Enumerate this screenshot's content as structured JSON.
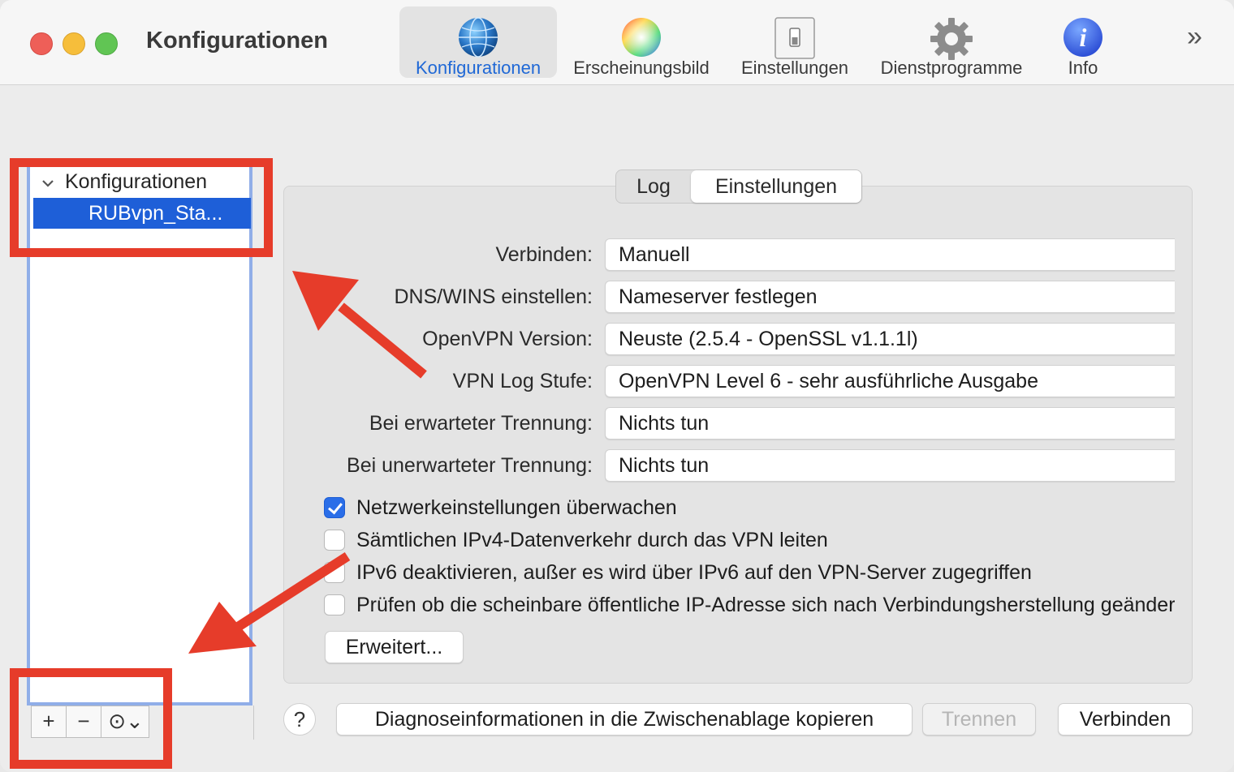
{
  "window": {
    "title": "Konfigurationen"
  },
  "toolbar": {
    "items": [
      {
        "label": "Konfigurationen",
        "icon": "globe-icon"
      },
      {
        "label": "Erscheinungsbild",
        "icon": "color-wheel-icon"
      },
      {
        "label": "Einstellungen",
        "icon": "switch-icon"
      },
      {
        "label": "Dienstprogramme",
        "icon": "gear-icon"
      },
      {
        "label": "Info",
        "icon": "info-icon"
      }
    ],
    "more": "»"
  },
  "sidebar": {
    "group_label": "Konfigurationen",
    "selected_item": "RUBvpn_Sta...",
    "add_label": "+",
    "remove_label": "−",
    "action_label": "⊙⌄"
  },
  "tabs": {
    "log": "Log",
    "settings": "Einstellungen"
  },
  "form": {
    "rows": [
      {
        "label": "Verbinden:",
        "value": "Manuell"
      },
      {
        "label": "DNS/WINS einstellen:",
        "value": "Nameserver festlegen"
      },
      {
        "label": "OpenVPN Version:",
        "value": "Neuste (2.5.4 - OpenSSL v1.1.1l)"
      },
      {
        "label": "VPN Log Stufe:",
        "value": "OpenVPN Level 6 - sehr ausführliche Ausgabe"
      },
      {
        "label": "Bei erwarteter Trennung:",
        "value": "Nichts tun"
      },
      {
        "label": "Bei unerwarteter Trennung:",
        "value": "Nichts tun"
      }
    ]
  },
  "checks": [
    {
      "label": "Netzwerkeinstellungen überwachen",
      "checked": true
    },
    {
      "label": "Sämtlichen IPv4-Datenverkehr durch das VPN leiten",
      "checked": false
    },
    {
      "label": "IPv6 deaktivieren, außer es wird über IPv6 auf den VPN-Server zugegriffen",
      "checked": false
    },
    {
      "label": "Prüfen ob die scheinbare öffentliche IP-Adresse sich nach Verbindungsherstellung geändert hat",
      "checked": false
    }
  ],
  "buttons": {
    "advanced": "Erweitert...",
    "help": "?",
    "copy_diagnostics": "Diagnoseinformationen in die Zwischenablage kopieren",
    "disconnect": "Trennen",
    "connect": "Verbinden"
  },
  "colors": {
    "annotation": "#e63c2a",
    "selection": "#1e5fd8",
    "accent": "#1f68d6"
  }
}
